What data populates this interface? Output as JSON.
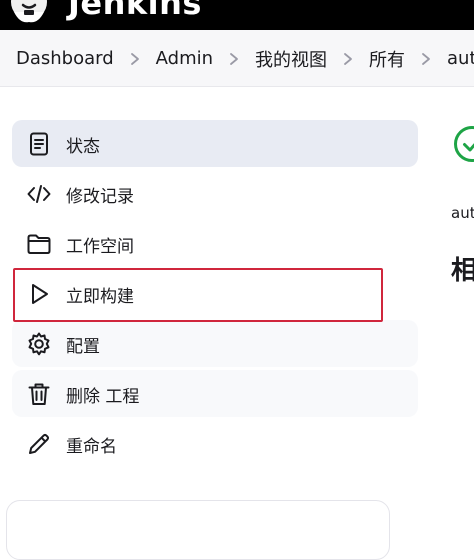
{
  "header": {
    "brand": "Jenkins",
    "logo_icon": "jenkins-butler-icon"
  },
  "breadcrumb": {
    "items": [
      "Dashboard",
      "Admin",
      "我的视图",
      "所有",
      "auto"
    ],
    "separator_icon": "chevron-right-icon"
  },
  "sidebar": {
    "items": [
      {
        "label": "状态",
        "icon": "document-icon",
        "state": "active"
      },
      {
        "label": "修改记录",
        "icon": "code-icon",
        "state": "normal"
      },
      {
        "label": "工作空间",
        "icon": "folder-icon",
        "state": "normal"
      },
      {
        "label": "立即构建",
        "icon": "play-icon",
        "state": "highlighted"
      },
      {
        "label": "配置",
        "icon": "gear-icon",
        "state": "hover"
      },
      {
        "label": "删除 工程",
        "icon": "trash-icon",
        "state": "hover"
      },
      {
        "label": "重命名",
        "icon": "pencil-icon",
        "state": "normal"
      }
    ]
  },
  "main": {
    "status_icon": "check-circle-icon",
    "status_color": "#1ea446",
    "text": "aut",
    "heading": "相"
  },
  "colors": {
    "topbar": "#000000",
    "active_item": "#e8ebf3",
    "highlight_border": "#d0263c"
  }
}
